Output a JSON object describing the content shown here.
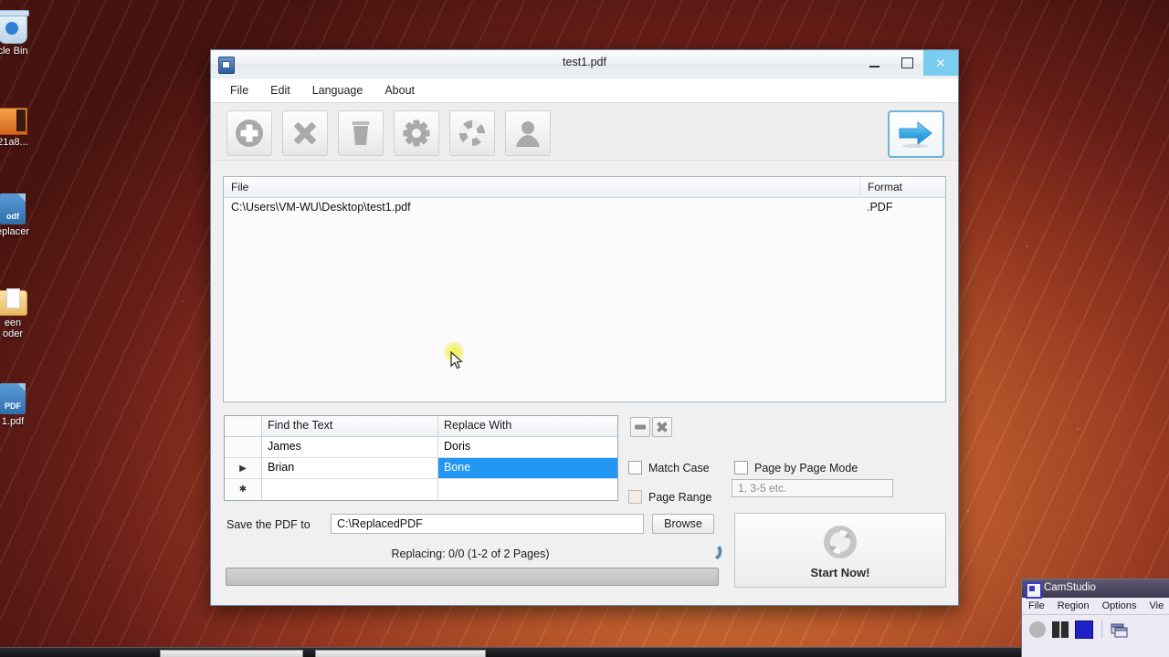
{
  "desktop": {
    "icons": [
      {
        "label": "cle Bin",
        "name": "recycle-bin",
        "type": "bin"
      },
      {
        "label": "21a8...",
        "name": "image-file",
        "type": "orange"
      },
      {
        "label": "eplacer",
        "name": "pdf-replacer-shortcut",
        "type": "pdf",
        "tag": "odf"
      },
      {
        "label": "een\noder",
        "name": "screen-recorder-folder",
        "type": "folder"
      },
      {
        "label": "1.pdf",
        "name": "test1-pdf-file",
        "type": "pdf",
        "tag": "PDF"
      }
    ]
  },
  "app": {
    "title": "test1.pdf",
    "title_icon": "pdf-document-icon",
    "window_buttons": {
      "minimize": "–",
      "maximize": "□",
      "close": "✕"
    },
    "menu": [
      "File",
      "Edit",
      "Language",
      "About"
    ],
    "toolbar": [
      {
        "name": "add-files-button",
        "icon": "plus-circle-icon"
      },
      {
        "name": "remove-file-button",
        "icon": "cross-icon"
      },
      {
        "name": "clear-list-button",
        "icon": "trash-icon"
      },
      {
        "name": "settings-button",
        "icon": "gear-icon"
      },
      {
        "name": "help-button",
        "icon": "lifebuoy-icon"
      },
      {
        "name": "account-button",
        "icon": "user-icon"
      },
      {
        "name": "go-button",
        "icon": "blue-right-arrow-icon"
      }
    ],
    "file_list": {
      "columns": [
        "File",
        "Format"
      ],
      "rows": [
        {
          "file": "C:\\Users\\VM-WU\\Desktop\\test1.pdf",
          "format": ".PDF"
        }
      ]
    },
    "replace_grid": {
      "columns": [
        "",
        "Find the Text",
        "Replace With"
      ],
      "rows": [
        {
          "marker": "",
          "find": "James",
          "replace": "Doris",
          "selected": false
        },
        {
          "marker": "▶",
          "find": "Brian",
          "replace": "Bone",
          "selected": true
        },
        {
          "marker": "✱",
          "find": "",
          "replace": "",
          "selected": false
        }
      ]
    },
    "grid_buttons": [
      {
        "name": "remove-row-button",
        "icon": "minus-box-icon"
      },
      {
        "name": "clear-rows-button",
        "icon": "cross-box-icon"
      }
    ],
    "options": {
      "match_case": {
        "label": "Match Case",
        "checked": false
      },
      "page_by_page": {
        "label": "Page by Page Mode",
        "checked": false
      },
      "page_range": {
        "label": "Page Range",
        "checked": false
      },
      "page_range_placeholder": "1, 3-5 etc."
    },
    "save": {
      "label": "Save the PDF to",
      "path": "C:\\ReplacedPDF",
      "browse": "Browse"
    },
    "status": "Replacing: 0/0 (1-2 of 2 Pages)",
    "progress_percent": 0,
    "start_button": {
      "label": "Start Now!",
      "icon": "refresh-circle-icon"
    },
    "accent_color": "#2196f3",
    "close_button_color": "#79cdee"
  },
  "camstudio": {
    "title": "CamStudio",
    "menu": [
      "File",
      "Region",
      "Options",
      "Vie"
    ],
    "toolbar": [
      {
        "name": "record-button",
        "icon": "record-circle-icon"
      },
      {
        "name": "pause-button",
        "icon": "pause-icon"
      },
      {
        "name": "stop-button",
        "icon": "stop-square-icon"
      },
      {
        "name": "window-select-button",
        "icon": "window-icon"
      }
    ]
  }
}
